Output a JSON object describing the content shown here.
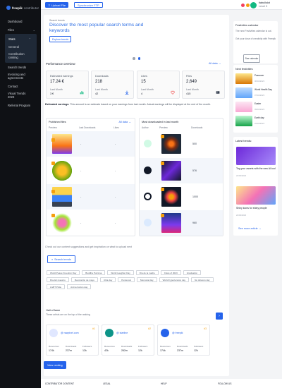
{
  "brand": {
    "name": "freepik",
    "suffix": "contributor"
  },
  "sidebar": {
    "items": [
      {
        "label": "Dashboard"
      },
      {
        "label": "Files"
      },
      {
        "label": "Stats"
      },
      {
        "label": "General"
      },
      {
        "label": "Contribution ranking"
      },
      {
        "label": "Search trends"
      },
      {
        "label": "Invoicing and agreements"
      },
      {
        "label": "Contact"
      },
      {
        "label": "Visual Trends 2023"
      },
      {
        "label": "Referral Program"
      }
    ]
  },
  "topbar": {
    "upload_label": "Upload File",
    "ftp_label": "Synchronize FTP",
    "user_name": "tiabullslot",
    "user_level": "Level 3"
  },
  "hero": {
    "label": "Search trends",
    "title": "Discover the most popular search terms and keywords",
    "button": "Explore trends"
  },
  "performance": {
    "title": "Performance overview",
    "all_link": "All data →",
    "stats": [
      {
        "label": "Estimated earnings",
        "value": "17.24 €",
        "last_label": "Last Month",
        "last_value": "3 €",
        "icon": "bar-chart-icon"
      },
      {
        "label": "Downloads",
        "value": "218",
        "last_label": "Last Month",
        "last_value": "42",
        "icon": "download-icon"
      },
      {
        "label": "Likes",
        "value": "15",
        "last_label": "Last Month",
        "last_value": "4",
        "icon": "heart-icon"
      },
      {
        "label": "Files",
        "value": "2,649",
        "last_label": "Last Month",
        "last_value": "415",
        "icon": "image-icon"
      }
    ],
    "note_bold": "Estimated earnings:",
    "note_text": " This amount is an estimate based on your earnings from last month. Actual earnings will be displayed at the end of the month."
  },
  "published": {
    "title": "Published files",
    "link": "All data →",
    "headers": [
      "Preview",
      "Last Downloads",
      "Likes"
    ],
    "rows": [
      {
        "downloads": "-",
        "likes": "-"
      },
      {
        "downloads": "-",
        "likes": "-"
      },
      {
        "downloads": "-",
        "likes": "-"
      },
      {
        "downloads": "-",
        "likes": "-"
      }
    ]
  },
  "most_downloaded": {
    "title": "Most downloaded in last month",
    "headers": [
      "Author",
      "Preview",
      "Downloads"
    ],
    "rows": [
      {
        "downloads": "500"
      },
      {
        "downloads": "576"
      },
      {
        "downloads": "1000"
      },
      {
        "downloads": "960"
      }
    ]
  },
  "suggestions": {
    "intro": "Check out our content suggestions and get inspiration on what to upload next",
    "button": "Search trends",
    "chips": [
      "World Peace Freedom Day",
      "Buddha Purnima",
      "World Laughter Day",
      "Día de la madre",
      "Class of 2023",
      "Graduation",
      "Día del maestro",
      "Revolución de mayo",
      "Ultra day",
      "Pentecost",
      "Memorial day",
      "World hypertension day",
      "No tobacco day",
      "LGBT Pride",
      "Anti terrorism day"
    ]
  },
  "hall_of_fame": {
    "title": "Hall of fame",
    "subtitle": "These artists are on the top of the ranking",
    "contributors": [
      {
        "name": "@ rawpixel.com",
        "rank": "#1",
        "m1_label": "Resources",
        "m1": "174k",
        "m2_label": "Downloads",
        "m2": "237m",
        "m3_label": "Followers",
        "m3": "12k"
      },
      {
        "name": "@ starline",
        "rank": "#2",
        "m1_label": "Resources",
        "m1": "42k",
        "m2_label": "Downloads",
        "m2": "262m",
        "m3_label": "Followers",
        "m3": "12k"
      },
      {
        "name": "@ freepik",
        "rank": "#3",
        "m1_label": "Resources",
        "m1": "174k",
        "m2_label": "Downloads",
        "m2": "237m",
        "m3_label": "Followers",
        "m3": "12k"
      }
    ],
    "button": "View ranking"
  },
  "right": {
    "calendar_title": "Festivities calendar",
    "calendar_text": "The new Festivities calendar is out.",
    "calendar_text2": "Get your dose of creativity with Freepik",
    "calendar_button": "See calendar",
    "next_title": "Next festivities",
    "festivities": [
      {
        "name": "Passover",
        "date": "06/04/2023"
      },
      {
        "name": "World Health Day",
        "date": "07/04/2023"
      },
      {
        "name": "Easter",
        "date": "09/04/2023"
      },
      {
        "name": "Earth day",
        "date": "22/04/2023"
      }
    ],
    "trends_title": "Latest trends:",
    "trends": [
      {
        "title": "Tag your assets with the new AI-tool",
        "date": "24/03/2023"
      },
      {
        "title": "Shiny icons for shiny people",
        "date": "24/03/2023"
      }
    ],
    "more_link": "See more article →"
  },
  "footer": {
    "col1": "CONTRIBUTOR CONTENT",
    "col2": "LEGAL",
    "col3": "HELP",
    "col4": "FOLLOW US"
  }
}
